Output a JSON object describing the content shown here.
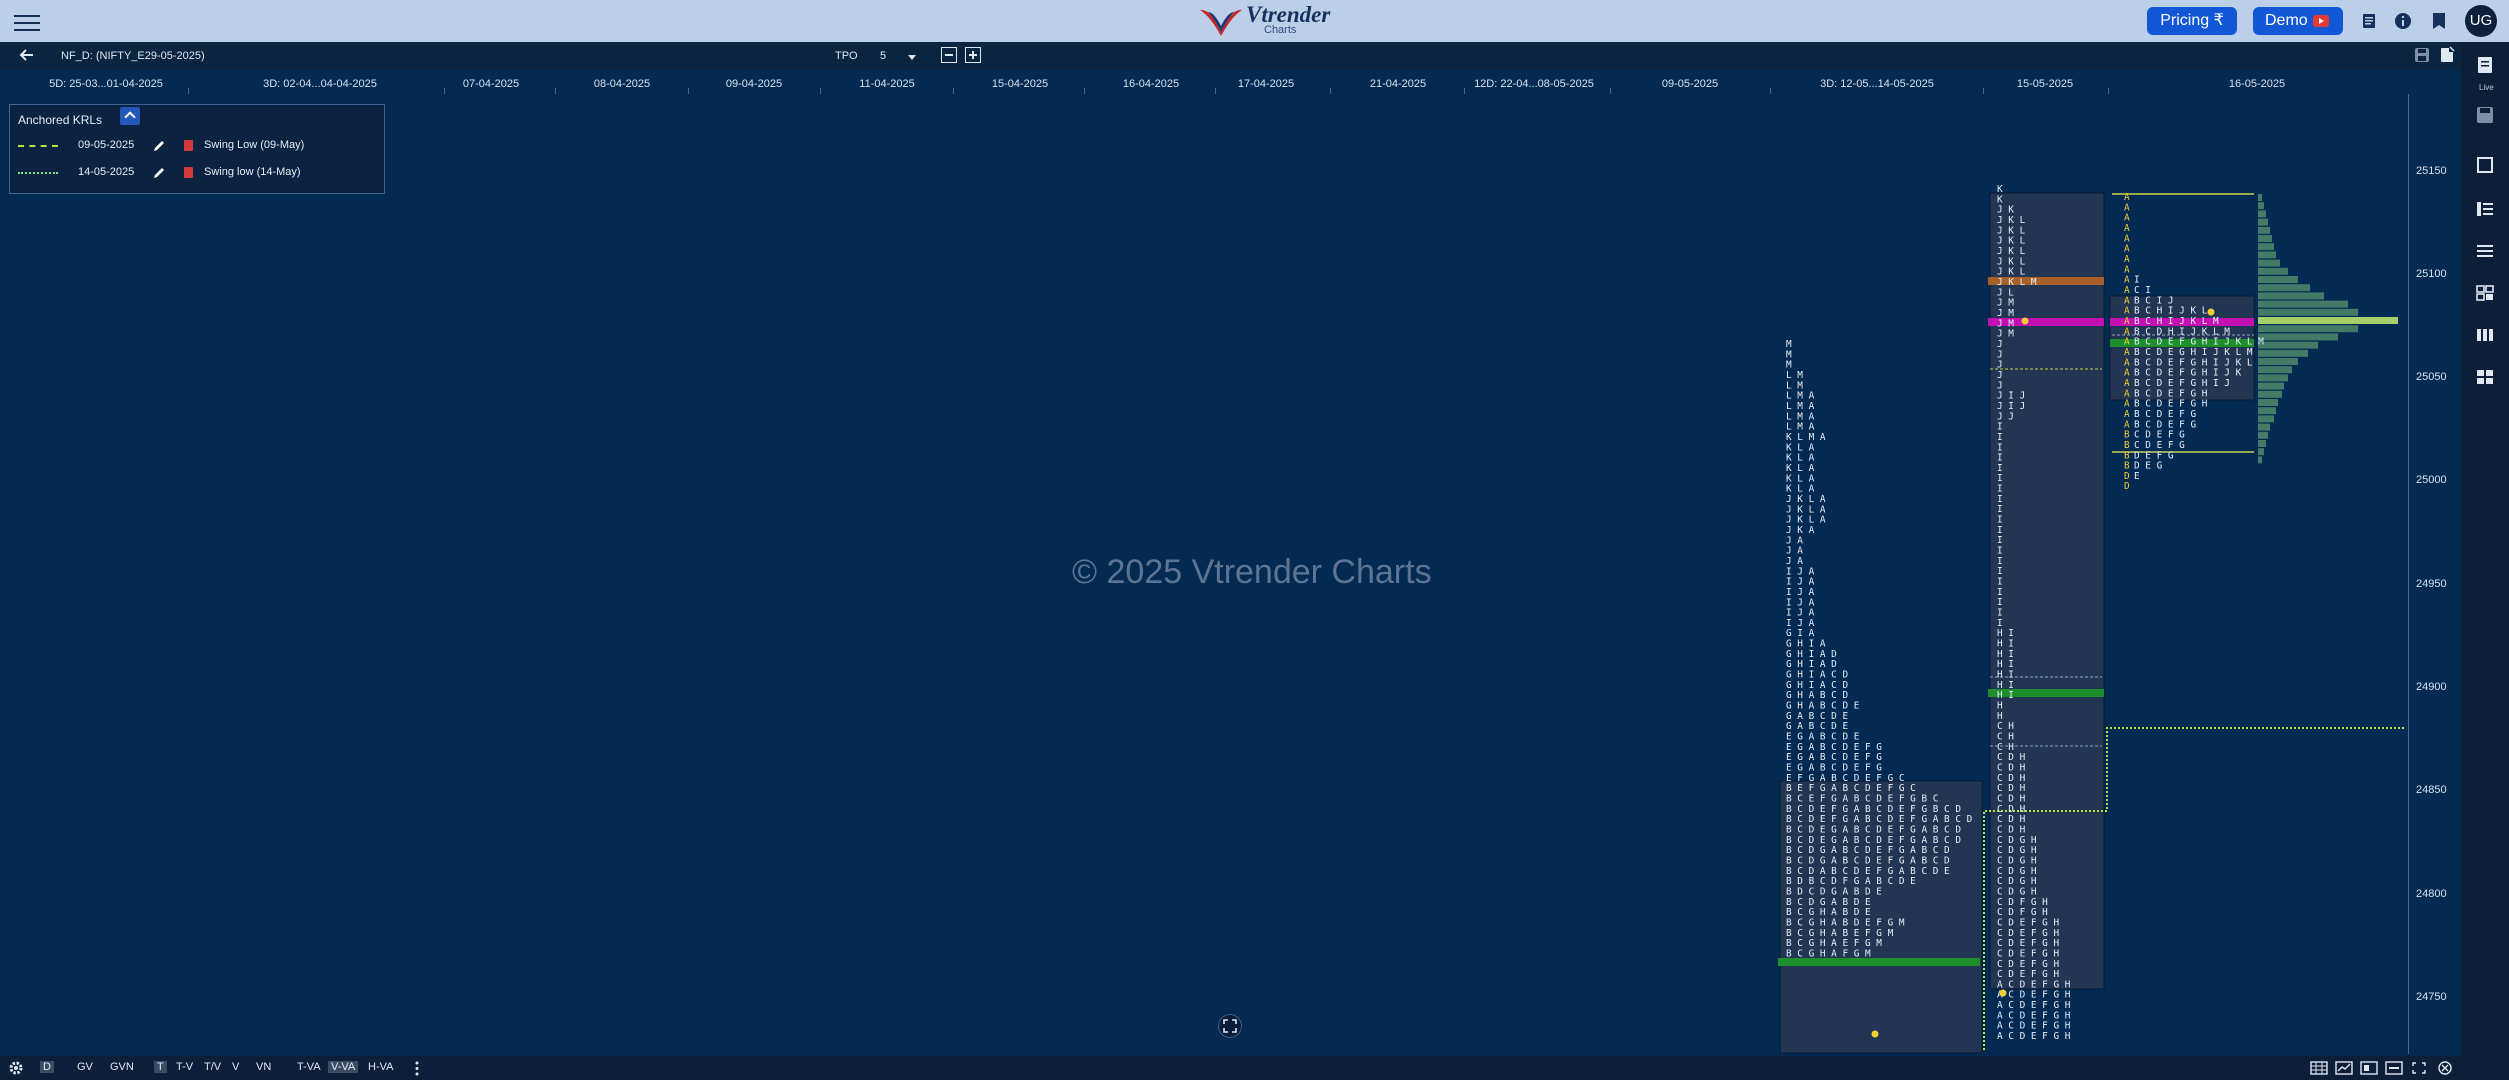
{
  "header": {
    "brand": "Vtrender",
    "brand_sub": "Charts",
    "pricing_label": "Pricing ₹",
    "demo_label": "Demo",
    "avatar_initials": "UG",
    "accent_color": "#1257d6"
  },
  "toolbar": {
    "ticker": "NF_D: (NIFTY_E29-05-2025)",
    "tpo_label": "TPO",
    "tpo_value": "5"
  },
  "date_axis": [
    "5D: 25-03...01-04-2025",
    "3D: 02-04...04-04-2025",
    "07-04-2025",
    "08-04-2025",
    "09-04-2025",
    "11-04-2025",
    "15-04-2025",
    "16-04-2025",
    "17-04-2025",
    "21-04-2025",
    "12D: 22-04...08-05-2025",
    "09-05-2025",
    "3D: 12-05...14-05-2025",
    "15-05-2025",
    "16-05-2025"
  ],
  "price_axis": [
    "25150",
    "25100",
    "25050",
    "25000",
    "24950",
    "24900",
    "24850",
    "24800",
    "24750"
  ],
  "watermark": "© 2025 Vtrender Charts",
  "krl_panel": {
    "title": "Anchored KRLs",
    "rows": [
      {
        "date": "09-05-2025",
        "name": "Swing Low (09-May)",
        "color": "#b7e33a"
      },
      {
        "date": "14-05-2025",
        "name": "Swing low (14-May)",
        "color": "#7de38a"
      }
    ]
  },
  "right_sidebar": {
    "live_label": "Live"
  },
  "bottom": {
    "buttons": [
      "D",
      "GV",
      "GVN",
      "T",
      "T-V",
      "T/V",
      "V",
      "VN",
      "T-VA",
      "V-VA",
      "H-VA"
    ],
    "active": [
      "D",
      "T",
      "V-VA"
    ]
  },
  "profiles": {
    "tpo_color": "#e8f0fb",
    "open_color": "#f3d032",
    "poc_green": "#1c8f2a",
    "poc_magenta": "#c410b2",
    "brown": "#a8602a",
    "histogram_color": "#4f8a6a"
  }
}
